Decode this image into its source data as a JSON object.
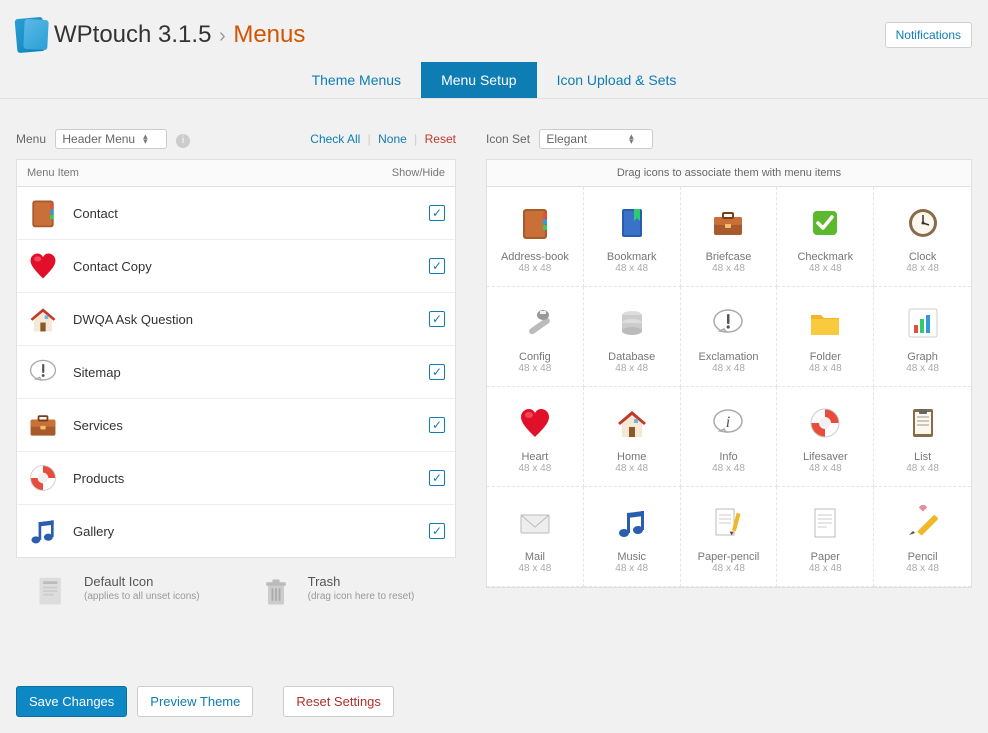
{
  "header": {
    "app_name": "WPtouch 3.1.5",
    "page_name": "Menus",
    "notifications_label": "Notifications"
  },
  "tabs": [
    {
      "label": "Theme Menus",
      "active": false
    },
    {
      "label": "Menu Setup",
      "active": true
    },
    {
      "label": "Icon Upload & Sets",
      "active": false
    }
  ],
  "menu_panel": {
    "menu_label": "Menu",
    "menu_select_value": "Header Menu",
    "links": {
      "check_all": "Check All",
      "none": "None",
      "reset": "Reset"
    },
    "col_item": "Menu Item",
    "col_showhide": "Show/Hide",
    "items": [
      {
        "name": "Contact",
        "icon": "address-book",
        "checked": true
      },
      {
        "name": "Contact Copy",
        "icon": "heart",
        "checked": true
      },
      {
        "name": "DWQA Ask Question",
        "icon": "home",
        "checked": true
      },
      {
        "name": "Sitemap",
        "icon": "exclamation",
        "checked": true
      },
      {
        "name": "Services",
        "icon": "briefcase",
        "checked": true
      },
      {
        "name": "Products",
        "icon": "lifesaver",
        "checked": true
      },
      {
        "name": "Gallery",
        "icon": "music",
        "checked": true
      }
    ]
  },
  "icon_panel": {
    "iconset_label": "Icon Set",
    "iconset_value": "Elegant",
    "grid_hint": "Drag icons to associate them with menu items",
    "icons": [
      {
        "name": "Address-book",
        "dim": "48 x 48",
        "key": "address-book"
      },
      {
        "name": "Bookmark",
        "dim": "48 x 48",
        "key": "bookmark"
      },
      {
        "name": "Briefcase",
        "dim": "48 x 48",
        "key": "briefcase"
      },
      {
        "name": "Checkmark",
        "dim": "48 x 48",
        "key": "checkmark"
      },
      {
        "name": "Clock",
        "dim": "48 x 48",
        "key": "clock"
      },
      {
        "name": "Config",
        "dim": "48 x 48",
        "key": "config"
      },
      {
        "name": "Database",
        "dim": "48 x 48",
        "key": "database"
      },
      {
        "name": "Exclamation",
        "dim": "48 x 48",
        "key": "exclamation"
      },
      {
        "name": "Folder",
        "dim": "48 x 48",
        "key": "folder"
      },
      {
        "name": "Graph",
        "dim": "48 x 48",
        "key": "graph"
      },
      {
        "name": "Heart",
        "dim": "48 x 48",
        "key": "heart"
      },
      {
        "name": "Home",
        "dim": "48 x 48",
        "key": "home"
      },
      {
        "name": "Info",
        "dim": "48 x 48",
        "key": "info"
      },
      {
        "name": "Lifesaver",
        "dim": "48 x 48",
        "key": "lifesaver"
      },
      {
        "name": "List",
        "dim": "48 x 48",
        "key": "list"
      },
      {
        "name": "Mail",
        "dim": "48 x 48",
        "key": "mail"
      },
      {
        "name": "Music",
        "dim": "48 x 48",
        "key": "music"
      },
      {
        "name": "Paper-pencil",
        "dim": "48 x 48",
        "key": "paper-pencil"
      },
      {
        "name": "Paper",
        "dim": "48 x 48",
        "key": "paper"
      },
      {
        "name": "Pencil",
        "dim": "48 x 48",
        "key": "pencil"
      }
    ]
  },
  "below": {
    "default_title": "Default Icon",
    "default_sub": "(applies to all unset icons)",
    "trash_title": "Trash",
    "trash_sub": "(drag icon here to reset)"
  },
  "footer": {
    "save": "Save Changes",
    "preview": "Preview Theme",
    "reset": "Reset Settings"
  }
}
